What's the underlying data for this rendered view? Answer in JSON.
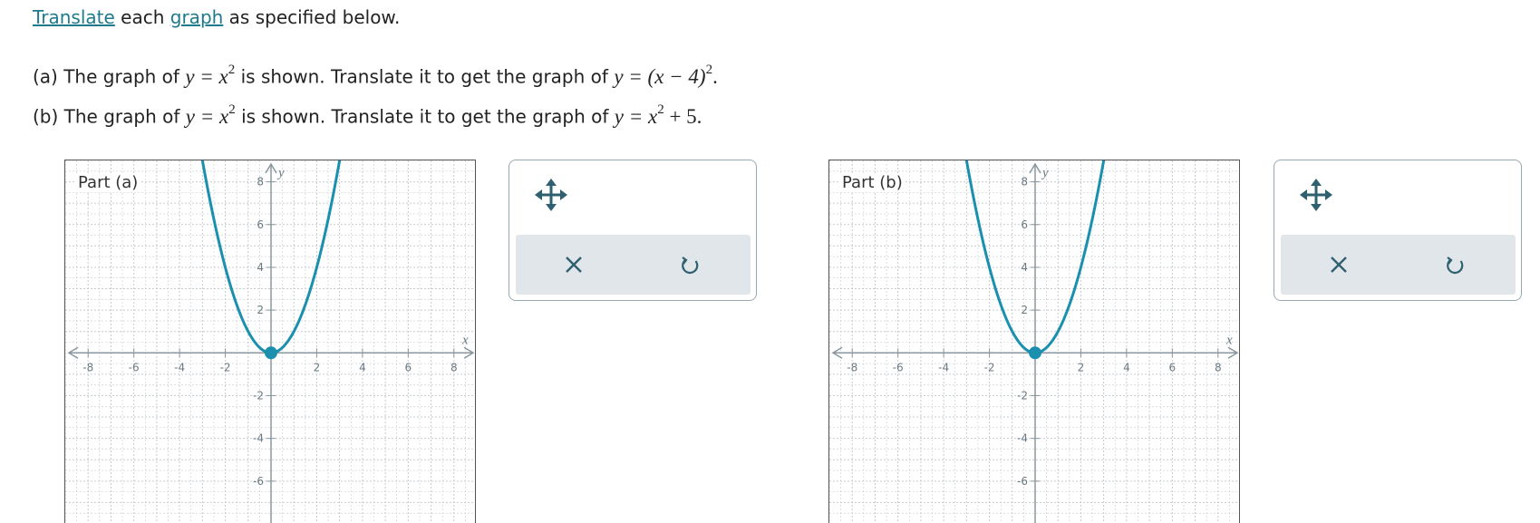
{
  "instructions": {
    "link_translate": "Translate",
    "word_each": "each",
    "link_graph": "graph",
    "rest": "as specified below."
  },
  "parts": [
    {
      "label_prefix": "(a) The graph of",
      "given_lhs": "y = x",
      "given_exp": "2",
      "middle": "is shown. Translate it to get the graph of",
      "target_lhs": "y =",
      "target_inner": "(x − 4)",
      "target_exp": "2",
      "target_suffix": ".",
      "graph_label": "Part (a)"
    },
    {
      "label_prefix": "(b) The graph of",
      "given_lhs": "y = x",
      "given_exp": "2",
      "middle": "is shown. Translate it to get the graph of",
      "target_lhs": "y = x",
      "target_exp": "2",
      "target_suffix": "+ 5.",
      "graph_label": "Part (b)"
    }
  ],
  "graph": {
    "x_axis_label": "x",
    "y_axis_label": "y",
    "x_range": [
      -9,
      9
    ],
    "y_range": [
      -8,
      9
    ],
    "x_ticks": [
      "-8",
      "-6",
      "-4",
      "-2",
      "2",
      "4",
      "6",
      "8"
    ],
    "y_ticks": [
      "8",
      "6",
      "4",
      "2",
      "-2",
      "-4",
      "-6"
    ],
    "curve": "y = x^2",
    "vertex": [
      0,
      0
    ],
    "curve_color": "#1a8fae",
    "grid_color": "#c5ccd1",
    "axis_color": "#8a979e"
  },
  "toolbox": {
    "move_icon": "move-arrows-icon",
    "clear_icon": "x-icon",
    "undo_icon": "undo-icon",
    "icon_color": "#2f6070"
  }
}
